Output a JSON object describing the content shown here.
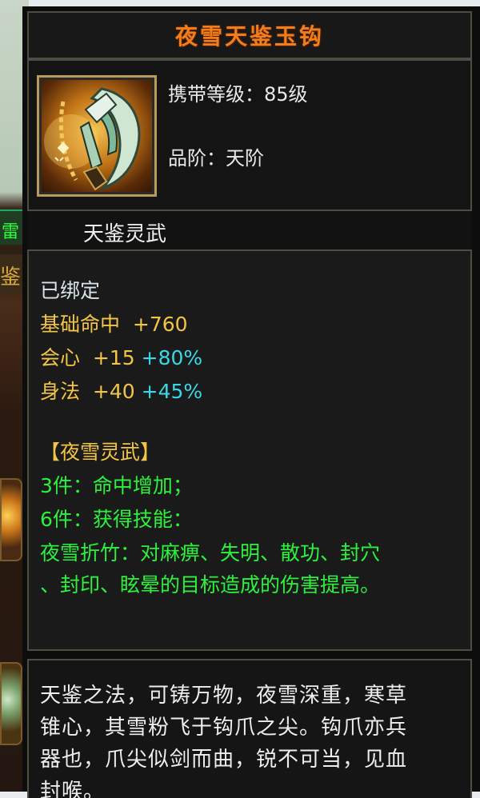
{
  "item": {
    "name": "夜雪天鉴玉钩",
    "icon": "jade-hook-weapon-icon",
    "carry_level_label": "携带等级：",
    "carry_level_value": "85级",
    "grade_label": "品阶：",
    "grade_value": "天阶",
    "category": "天鉴灵武"
  },
  "stats": {
    "bound": "已绑定",
    "base": {
      "label": "基础命中",
      "value": "+760"
    },
    "crit": {
      "label": "会心",
      "value": "+15",
      "bonus": "+80%"
    },
    "agility": {
      "label": "身法",
      "value": "+40",
      "bonus": "+45%"
    }
  },
  "set": {
    "name": "【夜雪灵武】",
    "bonus3": "3件：命中增加；",
    "bonus6": "6件：获得技能：",
    "skill_line1": "夜雪折竹：对麻痹、失明、散功、封穴",
    "skill_line2": "、封印、眩晕的目标造成的伤害提高。"
  },
  "description": {
    "line1": "天鉴之法，可铸万物，夜雪深重，寒草",
    "line2": "锥心，其雪粉飞于钩爪之尖。钩爪亦兵",
    "line3": "器也，爪尖似剑而曲，锐不可当，见血",
    "line4": "封喉。"
  },
  "backdrop": {
    "green_tab_glyph": "雷",
    "gold_tab_glyph": "鉴"
  },
  "colors": {
    "title": "#f47d1b",
    "stat_yellow": "#f2c544",
    "stat_cyan": "#39d8e6",
    "set_green": "#2cf23c",
    "frame": "#4f4c42"
  }
}
